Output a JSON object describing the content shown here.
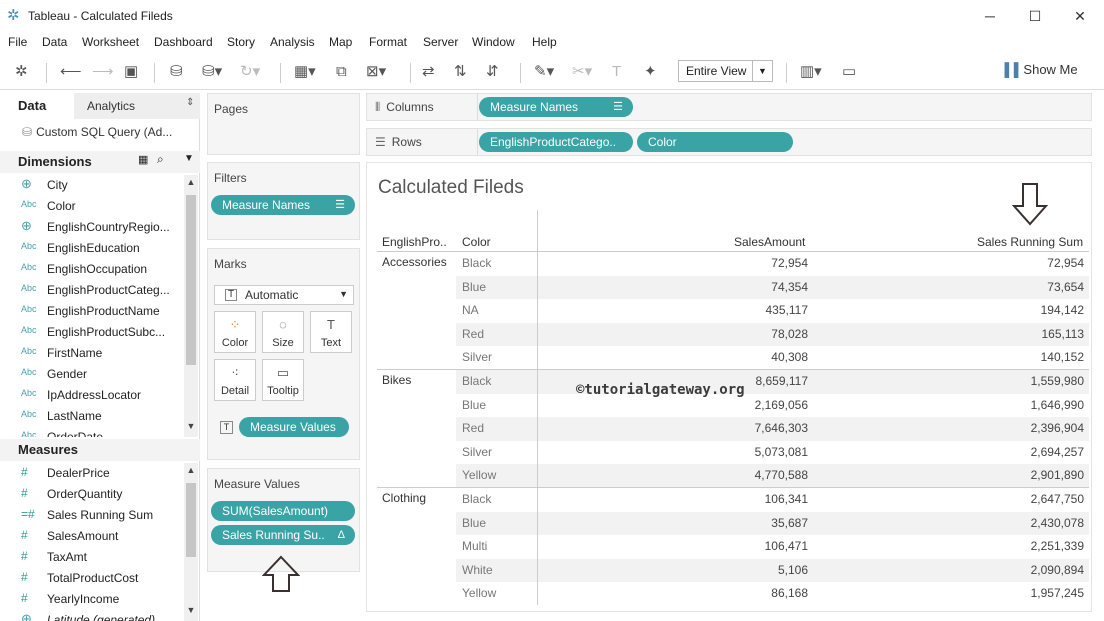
{
  "window": {
    "title": "Tableau - Calculated Fileds",
    "minimize": "─",
    "maximize": "☐",
    "close": "✕"
  },
  "menu": [
    "File",
    "Data",
    "Worksheet",
    "Dashboard",
    "Story",
    "Analysis",
    "Map",
    "Format",
    "Server",
    "Window",
    "Help"
  ],
  "toolbar": {
    "fit_value": "Entire View",
    "show_me_label": "Show Me"
  },
  "data_pane": {
    "tab_data": "Data",
    "tab_analytics": "Analytics",
    "datasource": "Custom SQL Query (Ad...",
    "dimensions_label": "Dimensions",
    "dimensions": [
      {
        "type": "globe",
        "name": "City"
      },
      {
        "type": "Abc",
        "name": "Color"
      },
      {
        "type": "globe",
        "name": "EnglishCountryRegio..."
      },
      {
        "type": "Abc",
        "name": "EnglishEducation"
      },
      {
        "type": "Abc",
        "name": "EnglishOccupation"
      },
      {
        "type": "Abc",
        "name": "EnglishProductCateg..."
      },
      {
        "type": "Abc",
        "name": "EnglishProductName"
      },
      {
        "type": "Abc",
        "name": "EnglishProductSubc..."
      },
      {
        "type": "Abc",
        "name": "FirstName"
      },
      {
        "type": "Abc",
        "name": "Gender"
      },
      {
        "type": "Abc",
        "name": "IpAddressLocator"
      },
      {
        "type": "Abc",
        "name": "LastName"
      },
      {
        "type": "Abc",
        "name": "OrderDate"
      }
    ],
    "measures_label": "Measures",
    "measures": [
      {
        "type": "#",
        "name": "DealerPrice"
      },
      {
        "type": "#",
        "name": "OrderQuantity"
      },
      {
        "type": "=#",
        "name": "Sales Running Sum"
      },
      {
        "type": "#",
        "name": "SalesAmount"
      },
      {
        "type": "#",
        "name": "TaxAmt"
      },
      {
        "type": "#",
        "name": "TotalProductCost"
      },
      {
        "type": "#",
        "name": "YearlyIncome"
      },
      {
        "type": "globe",
        "name": "Latitude (generated)"
      }
    ]
  },
  "cards": {
    "pages_title": "Pages",
    "filters_title": "Filters",
    "filter_pill": "Measure Names",
    "marks_title": "Marks",
    "mark_type": "Automatic",
    "mark_buttons": [
      "Color",
      "Size",
      "Text",
      "Detail",
      "Tooltip"
    ],
    "marks_pill": "Measure Values",
    "measure_values_title": "Measure Values",
    "mv_pills": [
      "SUM(SalesAmount)",
      "Sales Running Su.."
    ],
    "mv_pill2_icon": "Δ"
  },
  "shelves": {
    "columns_label": "Columns",
    "columns_pill": "Measure Names",
    "rows_label": "Rows",
    "rows_pills": [
      "EnglishProductCatego..",
      "Color"
    ]
  },
  "view": {
    "title": "Calculated Fileds",
    "headers": [
      "EnglishPro..",
      "Color",
      "SalesAmount",
      "Sales Running Sum"
    ],
    "watermark": "©tutorialgateway.org",
    "rows": [
      {
        "cat": "Accessories",
        "color": "Black",
        "sales": "72,954",
        "running": "72,954"
      },
      {
        "cat": "",
        "color": "Blue",
        "sales": "74,354",
        "running": "73,654"
      },
      {
        "cat": "",
        "color": "NA",
        "sales": "435,117",
        "running": "194,142"
      },
      {
        "cat": "",
        "color": "Red",
        "sales": "78,028",
        "running": "165,113"
      },
      {
        "cat": "",
        "color": "Silver",
        "sales": "40,308",
        "running": "140,152"
      },
      {
        "cat": "Bikes",
        "color": "Black",
        "sales": "8,659,117",
        "running": "1,559,980"
      },
      {
        "cat": "",
        "color": "Blue",
        "sales": "2,169,056",
        "running": "1,646,990"
      },
      {
        "cat": "",
        "color": "Red",
        "sales": "7,646,303",
        "running": "2,396,904"
      },
      {
        "cat": "",
        "color": "Silver",
        "sales": "5,073,081",
        "running": "2,694,257"
      },
      {
        "cat": "",
        "color": "Yellow",
        "sales": "4,770,588",
        "running": "2,901,890"
      },
      {
        "cat": "Clothing",
        "color": "Black",
        "sales": "106,341",
        "running": "2,647,750"
      },
      {
        "cat": "",
        "color": "Blue",
        "sales": "35,687",
        "running": "2,430,078"
      },
      {
        "cat": "",
        "color": "Multi",
        "sales": "106,471",
        "running": "2,251,339"
      },
      {
        "cat": "",
        "color": "White",
        "sales": "5,106",
        "running": "2,090,894"
      },
      {
        "cat": "",
        "color": "Yellow",
        "sales": "86,168",
        "running": "1,957,245"
      }
    ]
  }
}
